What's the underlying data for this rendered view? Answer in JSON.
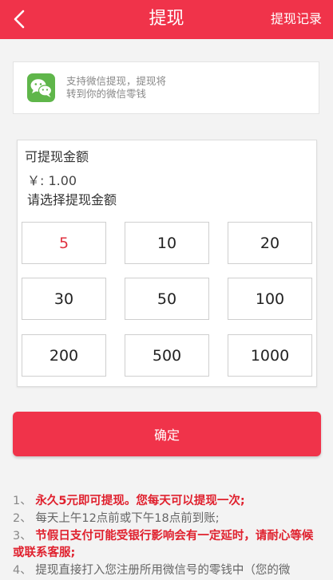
{
  "header": {
    "title": "提现",
    "records_label": "提现记录",
    "bg_color": "#f0334a"
  },
  "wechat": {
    "line1": "支持微信提现，提现将",
    "line2": "转到你的微信零钱",
    "icon": "wechat-icon",
    "icon_color": "#5fb64a"
  },
  "amount": {
    "label": "可提现金额",
    "balance": "￥: 1.00",
    "select_hint": "请选择提现金额",
    "options": [
      "5",
      "10",
      "20",
      "30",
      "50",
      "100",
      "200",
      "500",
      "1000"
    ],
    "selected": "5"
  },
  "confirm_label": "确定",
  "notes": [
    {
      "num": "1、",
      "text": "永久5元即可提现。您每天可以提现一次;",
      "style": "red"
    },
    {
      "num": "2、",
      "text": "每天上午12点前或下午18点前到账;",
      "style": "grey"
    },
    {
      "num": "3、",
      "text": "节假日支付可能受银行影响会有一定延时，请耐心等候或联系客服;",
      "style": "red"
    },
    {
      "num": "4、",
      "text": "提现直接打入您注册所用微信号的零钱中（您的微",
      "style": "grey"
    }
  ]
}
